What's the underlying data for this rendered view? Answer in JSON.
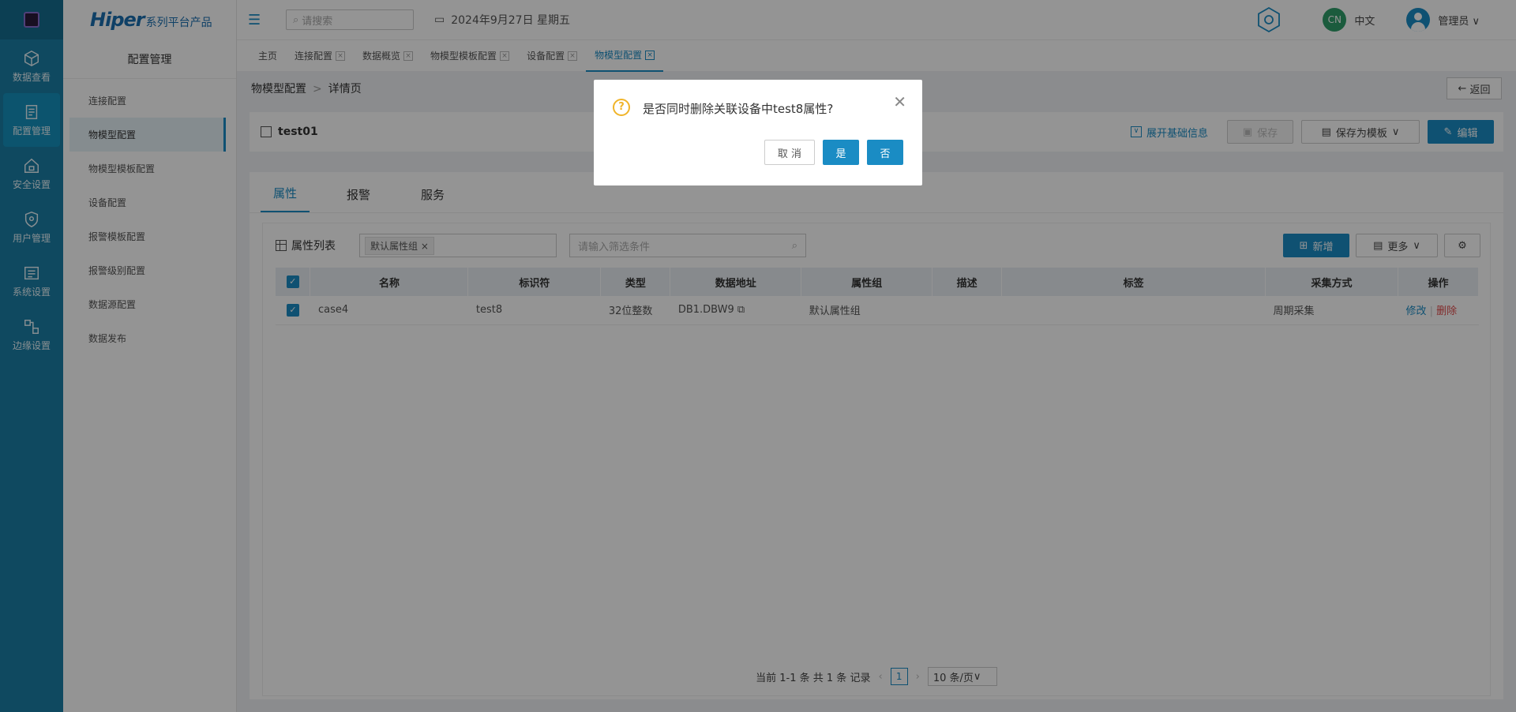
{
  "rail": {
    "items": [
      {
        "label": "数据查看",
        "icon": "cube-icon"
      },
      {
        "label": "配置管理",
        "icon": "config-icon"
      },
      {
        "label": "安全设置",
        "icon": "home-lock-icon"
      },
      {
        "label": "用户管理",
        "icon": "shield-icon"
      },
      {
        "label": "系统设置",
        "icon": "settings-icon"
      },
      {
        "label": "边缘设置",
        "icon": "network-icon"
      }
    ]
  },
  "brand": {
    "name": "Hiper",
    "tagline": "系列平台产品"
  },
  "sidebar": {
    "title": "配置管理",
    "items": [
      {
        "label": "连接配置"
      },
      {
        "label": "物模型配置"
      },
      {
        "label": "物模型模板配置"
      },
      {
        "label": "设备配置"
      },
      {
        "label": "报警模板配置"
      },
      {
        "label": "报警级别配置"
      },
      {
        "label": "数据源配置"
      },
      {
        "label": "数据发布"
      }
    ]
  },
  "topbar": {
    "search_placeholder": "请搜索",
    "date": "2024年9月27日 星期五",
    "lang_badge": "CN",
    "lang": "中文",
    "user": "管理员"
  },
  "tabs": [
    {
      "label": "主页"
    },
    {
      "label": "连接配置"
    },
    {
      "label": "数据概览"
    },
    {
      "label": "物模型模板配置"
    },
    {
      "label": "设备配置"
    },
    {
      "label": "物模型配置"
    }
  ],
  "breadcrumb": {
    "parent": "物模型配置",
    "sep": ">",
    "current": "详情页"
  },
  "back_label": "返回",
  "header": {
    "title": "test01",
    "expand_label": "展开基础信息",
    "save_label": "保存",
    "save_template_label": "保存为模板",
    "edit_label": "编辑"
  },
  "panel_tabs": [
    {
      "label": "属性"
    },
    {
      "label": "报警"
    },
    {
      "label": "服务"
    }
  ],
  "list": {
    "title": "属性列表",
    "group_chip": "默认属性组",
    "filter_placeholder": "请输入筛选条件",
    "add_label": "新增",
    "more_label": "更多"
  },
  "table": {
    "columns": [
      "名称",
      "标识符",
      "类型",
      "数据地址",
      "属性组",
      "描述",
      "标签",
      "采集方式",
      "操作"
    ],
    "rows": [
      {
        "name": "case4",
        "id": "test8",
        "type": "32位整数",
        "addr": "DB1.DBW9",
        "group": "默认属性组",
        "desc": "",
        "tags": "",
        "mode": "周期采集",
        "edit": "修改",
        "del": "删除"
      }
    ]
  },
  "pager": {
    "summary": "当前 1-1 条 共 1 条 记录",
    "page": "1",
    "size": "10 条/页"
  },
  "modal": {
    "message": "是否同时删除关联设备中test8属性?",
    "cancel": "取 消",
    "yes": "是",
    "no": "否"
  },
  "colors": {
    "accent": "#1a8cc4",
    "rail": "#1a7fa6",
    "danger": "#e04b4b",
    "warning": "#f0b429"
  }
}
